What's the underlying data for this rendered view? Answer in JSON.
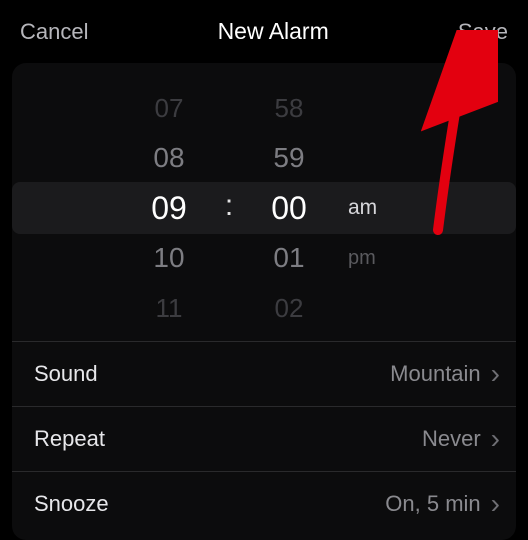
{
  "header": {
    "cancel": "Cancel",
    "title": "New Alarm",
    "save": "Save"
  },
  "picker": {
    "hours": [
      "07",
      "08",
      "09",
      "10",
      "11"
    ],
    "minutes": [
      "58",
      "59",
      "00",
      "01",
      "02"
    ],
    "separator": ":",
    "ampm": {
      "selected": "am",
      "other": "pm"
    }
  },
  "rows": {
    "sound": {
      "label": "Sound",
      "value": "Mountain"
    },
    "repeat": {
      "label": "Repeat",
      "value": "Never"
    },
    "snooze": {
      "label": "Snooze",
      "value": "On, 5 min"
    }
  },
  "annotation": {
    "arrow_color": "#e3000f"
  }
}
